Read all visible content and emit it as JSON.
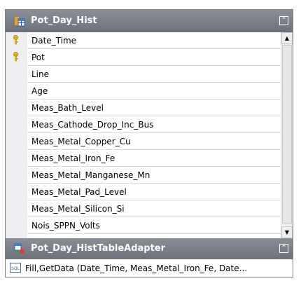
{
  "table": {
    "title": "Pot_Day_Hist",
    "columns": [
      {
        "name": "Date_Time",
        "is_key": true
      },
      {
        "name": "Pot",
        "is_key": true
      },
      {
        "name": "Line",
        "is_key": false
      },
      {
        "name": "Age",
        "is_key": false
      },
      {
        "name": "Meas_Bath_Level",
        "is_key": false
      },
      {
        "name": "Meas_Cathode_Drop_Inc_Bus",
        "is_key": false
      },
      {
        "name": "Meas_Metal_Copper_Cu",
        "is_key": false
      },
      {
        "name": "Meas_Metal_Iron_Fe",
        "is_key": false
      },
      {
        "name": "Meas_Metal_Manganese_Mn",
        "is_key": false
      },
      {
        "name": "Meas_Metal_Pad_Level",
        "is_key": false
      },
      {
        "name": "Meas_Metal_Silicon_Si",
        "is_key": false
      },
      {
        "name": "Nois_SPPN_Volts",
        "is_key": false
      }
    ]
  },
  "adapter": {
    "title": "Pot_Day_HistTableAdapter",
    "query_label": "Fill,GetData (Date_Time, Meas_Metal_Iron_Fe, Date..."
  },
  "icons": {
    "table": "datatable-icon",
    "key": "primary-key-icon",
    "adapter": "table-adapter-icon",
    "sql": "sql-query-icon",
    "collapse": "collapse-chevrons-icon"
  },
  "colors": {
    "header": "#7a7e87",
    "gutter": "#eceef2",
    "key": "#e8b41a"
  }
}
